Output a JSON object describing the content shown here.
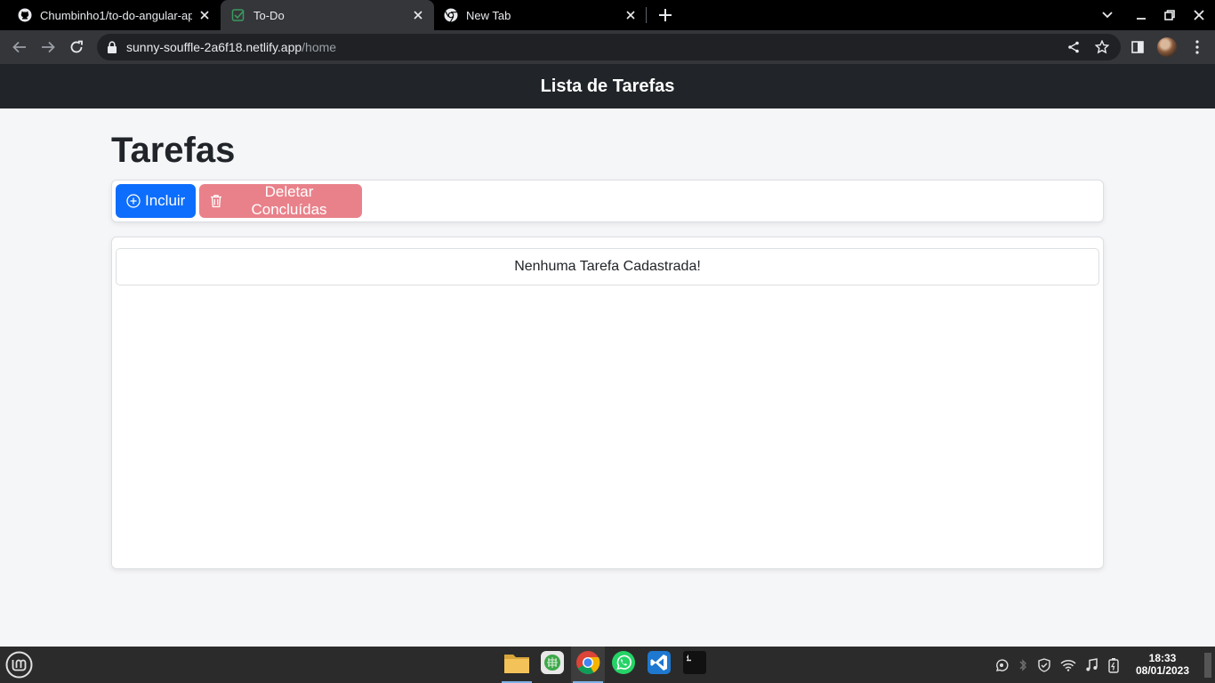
{
  "browser": {
    "tabs": [
      {
        "title": "Chumbinho1/to-do-angular-app",
        "favicon": "github-icon",
        "active": false
      },
      {
        "title": "To-Do",
        "favicon": "checkbox-icon",
        "active": true
      },
      {
        "title": "New Tab",
        "favicon": "chrome-icon",
        "active": false
      }
    ],
    "url_host": "sunny-souffle-2a6f18.netlify.app",
    "url_path": "/home"
  },
  "app": {
    "navbar_title": "Lista de Tarefas",
    "page_title": "Tarefas",
    "buttons": {
      "add_label": "Incluir",
      "delete_done_label": "Deletar Concluídas"
    },
    "empty_message": "Nenhuma Tarefa Cadastrada!"
  },
  "colors": {
    "navbar": "#212529",
    "primary": "#0d6efd",
    "danger_disabled": "#e9818a"
  },
  "taskbar": {
    "apps": [
      "files-icon",
      "spreadsheet-icon",
      "chrome-icon",
      "whatsapp-icon",
      "vscode-icon",
      "terminal-icon"
    ],
    "clock_time": "18:33",
    "clock_date": "08/01/2023"
  }
}
